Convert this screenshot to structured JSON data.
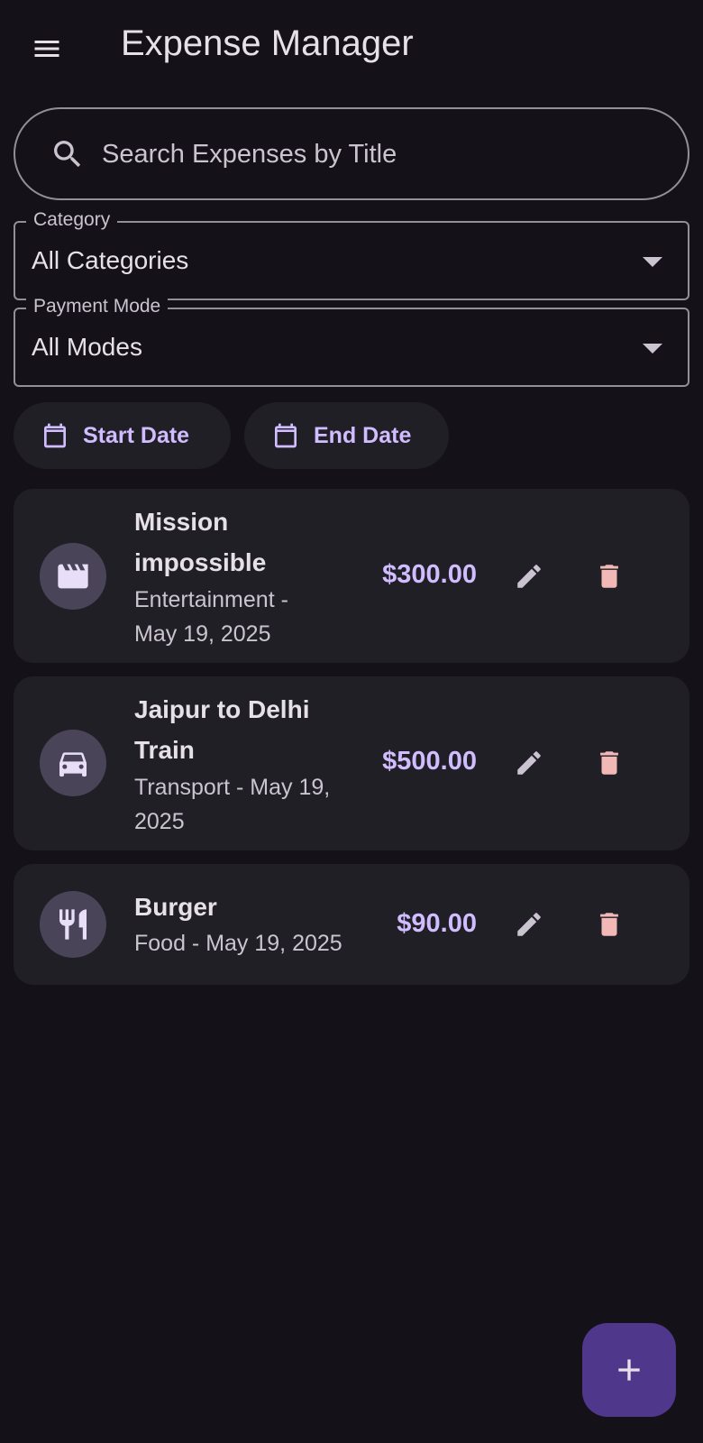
{
  "appbar": {
    "title": "Expense Manager",
    "menu_icon": "menu-icon"
  },
  "search": {
    "placeholder": "Search Expenses by Title",
    "value": "",
    "icon": "search-icon"
  },
  "filters": {
    "category": {
      "label": "Category",
      "value": "All Categories"
    },
    "payment_mode": {
      "label": "Payment Mode",
      "value": "All Modes"
    },
    "start_date": {
      "label": "Start Date",
      "icon": "calendar-icon"
    },
    "end_date": {
      "label": "End Date",
      "icon": "calendar-icon"
    }
  },
  "expenses": [
    {
      "title_line1": "Mission",
      "title_line2": "impossible",
      "sub_line1": "Entertainment -",
      "sub_line2": "May 19, 2025",
      "amount": "$300.00",
      "icon": "movie-icon"
    },
    {
      "title_line1": "Jaipur to Delhi",
      "title_line2": "Train",
      "sub_line1": "Transport - May 19,",
      "sub_line2": "2025",
      "amount": "$500.00",
      "icon": "car-icon"
    },
    {
      "title_line1": "Burger",
      "sub_line1": "Food - May 19, 2025",
      "amount": "$90.00",
      "icon": "restaurant-icon"
    }
  ],
  "colors": {
    "background": "#141218",
    "card": "#211F26",
    "accent": "#D0BCFF",
    "delete": "#F2B8B5",
    "fab": "#4F378B"
  },
  "fab": {
    "icon": "add-icon"
  }
}
